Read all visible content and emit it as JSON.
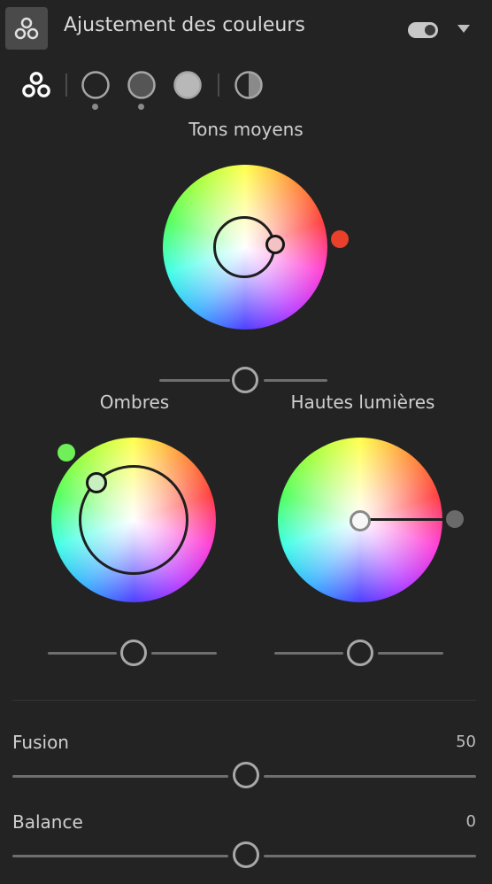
{
  "header": {
    "title": "Ajustement des couleurs",
    "toggle_on": true
  },
  "modes": [
    {
      "name": "all"
    },
    {
      "name": "shadows"
    },
    {
      "name": "midtones"
    },
    {
      "name": "highlights"
    },
    {
      "name": "global"
    }
  ],
  "wheels": {
    "midtones": {
      "label": "Tons moyens",
      "accent": "#e8402a"
    },
    "shadows": {
      "label": "Ombres",
      "accent": "#6fef58"
    },
    "highlights": {
      "label": "Hautes lumières",
      "accent": "#6a6a6a"
    }
  },
  "sliders": {
    "fusion": {
      "label": "Fusion",
      "value": "50"
    },
    "balance": {
      "label": "Balance",
      "value": "0"
    }
  },
  "colors": {
    "background": "#232323",
    "text": "#d6d6d6",
    "track": "#6f6f6f",
    "knob_border": "#a8a8a8"
  }
}
